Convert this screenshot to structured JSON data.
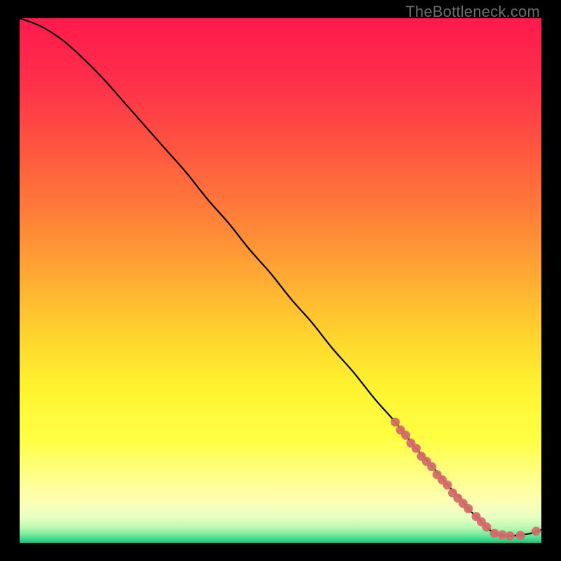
{
  "watermark": "TheBottleneck.com",
  "chart_data": {
    "type": "line",
    "title": "",
    "xlabel": "",
    "ylabel": "",
    "xlim": [
      0,
      100
    ],
    "ylim": [
      0,
      100
    ],
    "grid": false,
    "series": [
      {
        "name": "curve",
        "x": [
          0,
          4,
          8,
          12,
          16,
          20,
          24,
          28,
          32,
          36,
          40,
          44,
          48,
          52,
          56,
          60,
          64,
          68,
          72,
          76,
          80,
          82,
          84,
          86,
          88,
          90,
          92,
          94,
          96,
          98,
          100
        ],
        "y": [
          100,
          98.5,
          96,
          92.5,
          88.5,
          84,
          79.5,
          75,
          70.5,
          65.5,
          61,
          56,
          51.5,
          46.5,
          42,
          37,
          32.5,
          27.5,
          23,
          18,
          13.5,
          11,
          9,
          6.5,
          4.5,
          2.5,
          1.5,
          1.3,
          1.5,
          1.8,
          2.5
        ]
      }
    ],
    "highlight_points": {
      "name": "dots",
      "color": "#d66a6a",
      "x": [
        72,
        73,
        74,
        75,
        76,
        77,
        78,
        79,
        80,
        81,
        82,
        83,
        84,
        85,
        86,
        87.5,
        88.5,
        89.5,
        91,
        92.5,
        94,
        96,
        99
      ],
      "y": [
        23,
        21.5,
        20.5,
        19,
        18,
        16.5,
        15.5,
        14.5,
        13,
        12,
        11,
        9.5,
        8.5,
        7.5,
        6.5,
        5,
        4,
        3,
        1.8,
        1.5,
        1.3,
        1.4,
        2.2
      ]
    },
    "background_gradient": {
      "stops": [
        {
          "pos": 0.0,
          "color": "#ff1a4d"
        },
        {
          "pos": 0.12,
          "color": "#ff2f4a"
        },
        {
          "pos": 0.24,
          "color": "#ff5340"
        },
        {
          "pos": 0.36,
          "color": "#ff7a3a"
        },
        {
          "pos": 0.48,
          "color": "#ffa533"
        },
        {
          "pos": 0.6,
          "color": "#ffd22e"
        },
        {
          "pos": 0.7,
          "color": "#fff22f"
        },
        {
          "pos": 0.8,
          "color": "#ffff42"
        },
        {
          "pos": 0.875,
          "color": "#ffff8a"
        },
        {
          "pos": 0.92,
          "color": "#fdffb2"
        },
        {
          "pos": 0.952,
          "color": "#e8ffc4"
        },
        {
          "pos": 0.972,
          "color": "#b8f8b0"
        },
        {
          "pos": 0.986,
          "color": "#6ee89a"
        },
        {
          "pos": 0.994,
          "color": "#33d98c"
        },
        {
          "pos": 1.0,
          "color": "#17c97e"
        }
      ]
    }
  }
}
